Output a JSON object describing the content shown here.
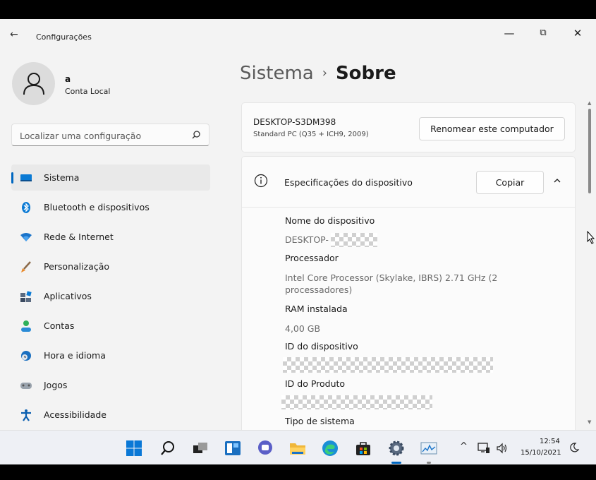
{
  "window": {
    "title": "Configurações",
    "back_icon": "back-arrow-icon",
    "minimize_glyph": "—",
    "maximize_glyph": "⧉",
    "close_glyph": "✕"
  },
  "user": {
    "name": "a",
    "account_type": "Conta Local",
    "avatar_icon": "person-icon"
  },
  "search": {
    "placeholder": "Localizar uma configuração",
    "icon": "search-icon"
  },
  "sidebar": {
    "items": [
      {
        "label": "Sistema",
        "icon": "monitor-icon",
        "active": true
      },
      {
        "label": "Bluetooth e dispositivos",
        "icon": "bluetooth-icon"
      },
      {
        "label": "Rede & Internet",
        "icon": "wifi-icon"
      },
      {
        "label": "Personalização",
        "icon": "brush-icon"
      },
      {
        "label": "Aplicativos",
        "icon": "apps-icon"
      },
      {
        "label": "Contas",
        "icon": "account-icon"
      },
      {
        "label": "Hora e idioma",
        "icon": "globe-clock-icon"
      },
      {
        "label": "Jogos",
        "icon": "gamepad-icon"
      },
      {
        "label": "Acessibilidade",
        "icon": "accessibility-icon"
      }
    ]
  },
  "page": {
    "breadcrumb_parent": "Sistema",
    "breadcrumb_separator": "›",
    "title": "Sobre"
  },
  "device_card": {
    "name": "DESKTOP-S3DM398",
    "model": "Standard PC (Q35 + ICH9, 2009)",
    "rename_button": "Renomear este computador"
  },
  "specs": {
    "title": "Especificações do dispositivo",
    "copy_button": "Copiar",
    "items": [
      {
        "label": "Nome do dispositivo",
        "value": "DESKTOP-"
      },
      {
        "label": "Processador",
        "value": "Intel Core Processor (Skylake, IBRS)   2.71 GHz  (2 processadores)"
      },
      {
        "label": "RAM instalada",
        "value": "4,00 GB"
      },
      {
        "label": "ID do dispositivo",
        "value": ""
      },
      {
        "label": "ID do Produto",
        "value": ""
      },
      {
        "label": "Tipo de sistema",
        "value": ""
      }
    ]
  },
  "taskbar": {
    "icons": [
      "windows-start-icon",
      "search-icon",
      "task-view-icon",
      "widgets-icon",
      "chat-icon",
      "file-explorer-icon",
      "edge-icon",
      "store-icon",
      "settings-icon",
      "performance-monitor-icon"
    ],
    "tray": {
      "chevron": "^",
      "network_icon": "network-icon",
      "volume_icon": "volume-icon",
      "time": "12:54",
      "date": "15/10/2021",
      "focus_icon": "focus-assist-icon"
    }
  },
  "colors": {
    "accent": "#0067c0",
    "window_bg": "#f3f3f3",
    "card_bg": "#fbfbfb"
  }
}
